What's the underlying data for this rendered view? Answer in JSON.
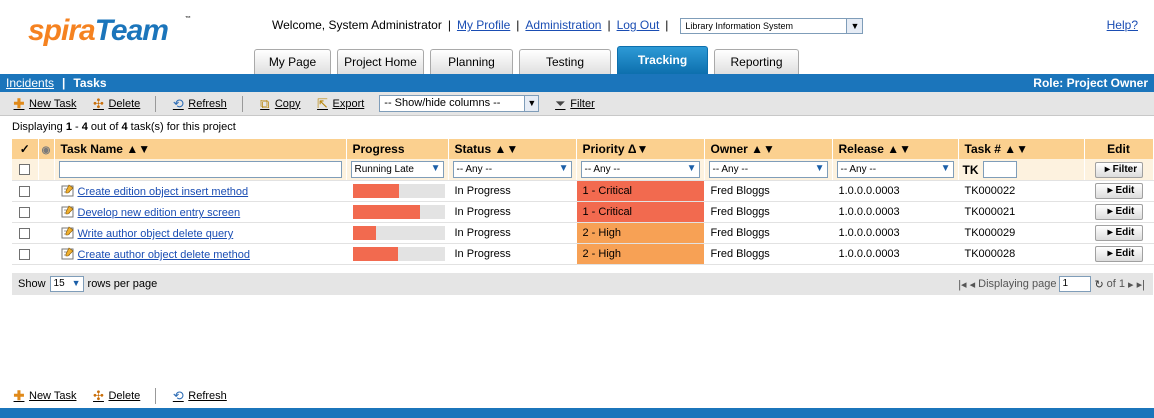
{
  "header": {
    "logo_part1": "spira",
    "logo_part2": "Team",
    "logo_tm": "™",
    "welcome": "Welcome, System Administrator",
    "links": [
      "My Profile",
      "Administration",
      "Log Out"
    ],
    "project": "Library Information System",
    "help": "Help?"
  },
  "tabs": [
    {
      "label": "My Page",
      "active": false
    },
    {
      "label": "Project Home",
      "active": false
    },
    {
      "label": "Planning",
      "active": false
    },
    {
      "label": "Testing",
      "active": false
    },
    {
      "label": "Tracking",
      "active": true
    },
    {
      "label": "Reporting",
      "active": false
    }
  ],
  "subnav": {
    "incidents": "Incidents",
    "tasks": "Tasks",
    "role": "Role: Project Owner"
  },
  "toolbar": {
    "new_task": "New Task",
    "delete": "Delete",
    "refresh": "Refresh",
    "copy": "Copy",
    "export": "Export",
    "columns_select": "-- Show/hide columns --",
    "filter": "Filter"
  },
  "summary": {
    "pre": "Displaying ",
    "from": "1",
    "dash": " - ",
    "to": "4",
    "mid": " out of ",
    "total": "4",
    "post": " task(s) for this project"
  },
  "columns": {
    "check": "✓",
    "attach": "",
    "name": "Task Name ▲▼",
    "progress": "Progress",
    "status": "Status ▲▼",
    "priority": "Priority Δ▼",
    "owner": "Owner ▲▼",
    "release": "Release ▲▼",
    "tasknum": "Task # ▲▼",
    "edit": "Edit"
  },
  "filters": {
    "progress": "Running Late",
    "status": "-- Any --",
    "priority": "-- Any --",
    "owner": "-- Any --",
    "release": "-- Any --",
    "tasknum_prefix": "TK",
    "filter_button": "▸ Filter"
  },
  "rows": [
    {
      "name": "Create edition object insert method",
      "progress": 0.5,
      "status": "In Progress",
      "priority": "1 - Critical",
      "priority_color": "#f26a4f",
      "owner": "Fred Bloggs",
      "release": "1.0.0.0.0003",
      "tasknum": "TK000022",
      "edit": "▸ Edit"
    },
    {
      "name": "Develop new edition entry screen",
      "progress": 0.73,
      "status": "In Progress",
      "priority": "1 - Critical",
      "priority_color": "#f26a4f",
      "owner": "Fred Bloggs",
      "release": "1.0.0.0.0003",
      "tasknum": "TK000021",
      "edit": "▸ Edit"
    },
    {
      "name": "Write author object delete query",
      "progress": 0.25,
      "status": "In Progress",
      "priority": "2 - High",
      "priority_color": "#f7a155",
      "owner": "Fred Bloggs",
      "release": "1.0.0.0.0003",
      "tasknum": "TK000029",
      "edit": "▸ Edit"
    },
    {
      "name": "Create author object delete method",
      "progress": 0.49,
      "status": "In Progress",
      "priority": "2 - High",
      "priority_color": "#f7a155",
      "owner": "Fred Bloggs",
      "release": "1.0.0.0.0003",
      "tasknum": "TK000028",
      "edit": "▸ Edit"
    }
  ],
  "footer": {
    "show": "Show",
    "rows_per_page_value": "15",
    "rows_per_page": "rows per page",
    "first_prev": "|◂ ◂",
    "displaying_page": "Displaying page",
    "page": "1",
    "of_pages": "of 1",
    "next_last": "▸ ▸|"
  },
  "bottom_toolbar": {
    "new_task": "New Task",
    "delete": "Delete",
    "refresh": "Refresh"
  },
  "colors": {
    "brand_blue": "#1b75bb",
    "brand_orange": "#f58220",
    "header_row": "#fbd08f",
    "progress_fill": "#f26a4f"
  }
}
